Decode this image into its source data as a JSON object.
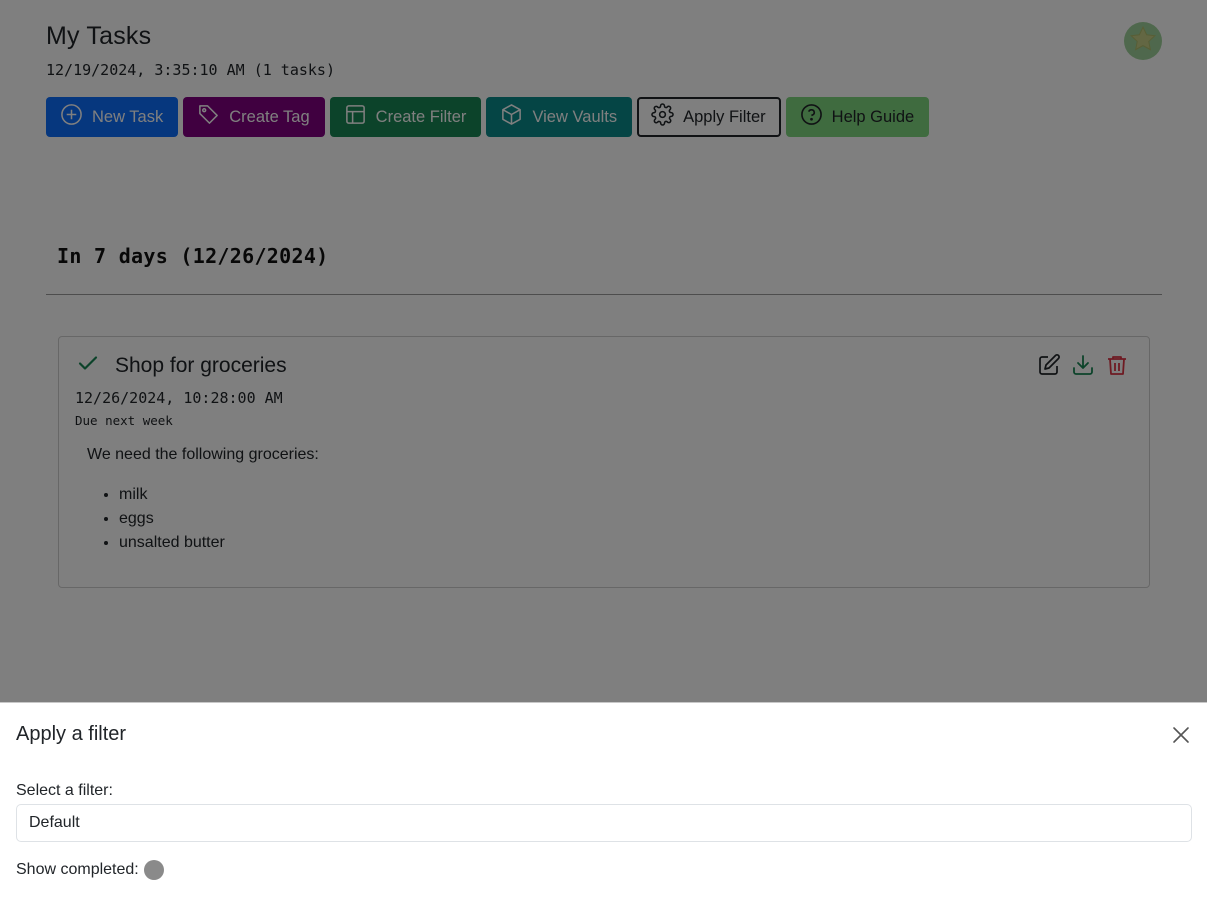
{
  "header": {
    "title": "My Tasks",
    "subtitle": "12/19/2024, 3:35:10 AM (1 tasks)"
  },
  "toolbar": {
    "buttons": [
      {
        "label": "New Task",
        "icon": "plus-circle-icon",
        "color": "#0d6efd"
      },
      {
        "label": "Create Tag",
        "icon": "tag-icon",
        "color": "#800080"
      },
      {
        "label": "Create Filter",
        "icon": "table-layout-icon",
        "color": "#198754"
      },
      {
        "label": "View Vaults",
        "icon": "box-icon",
        "color": "#0a8a8a"
      },
      {
        "label": "Apply Filter",
        "icon": "gear-icon",
        "color": "#ffffff"
      },
      {
        "label": "Help Guide",
        "icon": "question-circle-icon",
        "color": "#7ed67e"
      }
    ]
  },
  "profile": {
    "icon": "star-icon",
    "color": "#9fd19a"
  },
  "group": {
    "heading": "In 7 days (12/26/2024)"
  },
  "task": {
    "title": "Shop for groceries",
    "datetime": "12/26/2024, 10:28:00 AM",
    "note": "Due next week",
    "body_intro": "We need the following groceries:",
    "items": [
      "milk",
      "eggs",
      "unsalted butter"
    ],
    "status_icon": "check-icon",
    "actions": [
      "edit-icon",
      "download-icon",
      "trash-icon"
    ]
  },
  "filter_sheet": {
    "title": "Apply a filter",
    "select_label": "Select a filter:",
    "selected_filter": "Default",
    "show_completed_label": "Show completed:"
  }
}
